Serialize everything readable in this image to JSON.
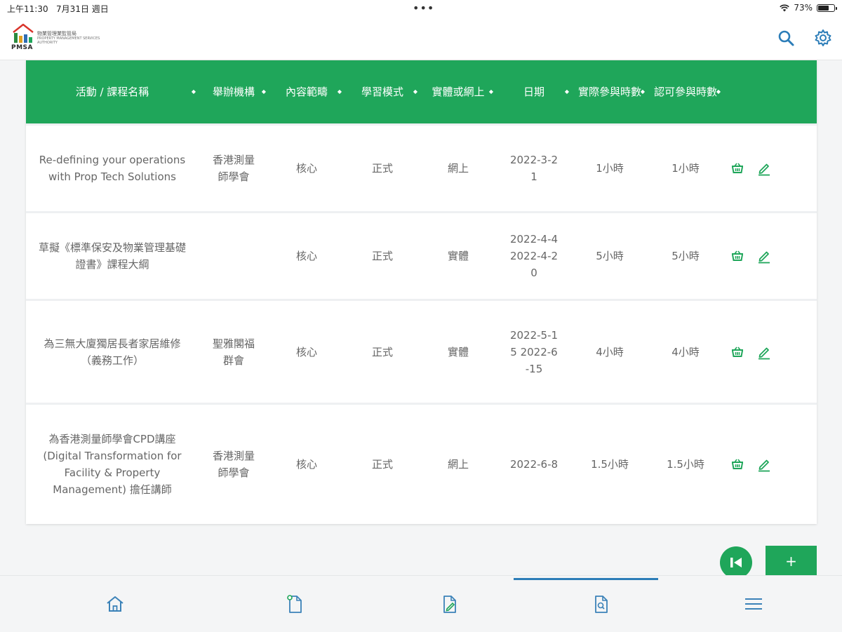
{
  "status_bar": {
    "time": "上午11:30",
    "date": "7月31日 週日",
    "battery": "73%",
    "battery_level": 0.73
  },
  "app": {
    "logo_text_cn": "物業管理業監管局",
    "logo_text_en": "PROPERTY MANAGEMENT SERVICES AUTHORITY",
    "logo_word": "PMSA",
    "icons": [
      "search-icon",
      "gear-icon"
    ]
  },
  "table": {
    "headers": [
      "活動 / 課程名稱",
      "舉辦機構",
      "內容範疇",
      "學習模式",
      "實體或網上",
      "日期",
      "實際參與時數",
      "認可參與時數"
    ],
    "rows": [
      {
        "name": "Re-defining your operations with Prop Tech Solutions",
        "organizer": "香港測量師學會",
        "scope": "核心",
        "mode": "正式",
        "format": "網上",
        "date": "2022-3-21",
        "actual_hours": "1小時",
        "approved_hours": "1小時"
      },
      {
        "name": "草擬《標準保安及物業管理基礎證書》課程大綱",
        "organizer": "",
        "scope": "核心",
        "mode": "正式",
        "format": "實體",
        "date": "2022-4-4 2022-4-20",
        "actual_hours": "5小時",
        "approved_hours": "5小時"
      },
      {
        "name": "為三無大廈獨居長者家居維修 （義務工作）",
        "organizer": "聖雅閣福群會",
        "scope": "核心",
        "mode": "正式",
        "format": "實體",
        "date": "2022-5-15 2022-6-15",
        "actual_hours": "4小時",
        "approved_hours": "4小時"
      },
      {
        "name": "為香港測量師學會CPD講座 (Digital Transformation for Facility & Property Management) 擔任講師",
        "organizer": "香港測量師學會",
        "scope": "核心",
        "mode": "正式",
        "format": "網上",
        "date": "2022-6-8",
        "actual_hours": "1.5小時",
        "approved_hours": "1.5小時"
      }
    ],
    "row_action_icons": [
      "basket-icon",
      "edit-icon"
    ]
  },
  "fab": {
    "add_label": "+",
    "first_icon": "skip-to-first-icon"
  },
  "tabbar": {
    "icons": [
      "home-icon",
      "document-icon",
      "edit-document-icon",
      "search-document-icon",
      "menu-icon"
    ],
    "active_index": 3
  },
  "colors": {
    "accent_green": "#1fa65a",
    "header_blue": "#2c7db8",
    "tab_icon_blue": "#3b82b8"
  }
}
